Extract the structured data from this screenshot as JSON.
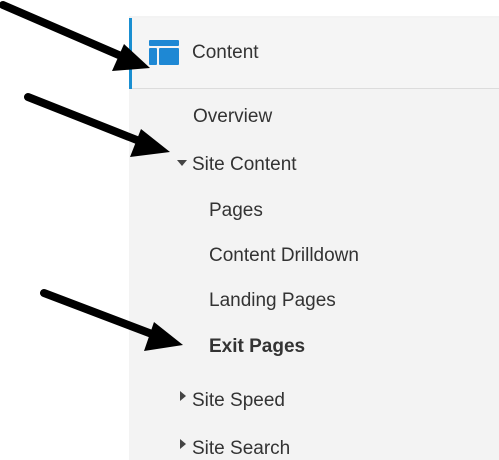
{
  "header": {
    "label": "Content",
    "icon": "content-layout-icon"
  },
  "nav": {
    "overview": "Overview",
    "site_content": {
      "label": "Site Content",
      "expanded": true,
      "children": [
        "Pages",
        "Content Drilldown",
        "Landing Pages",
        "Exit Pages"
      ],
      "selected": "Exit Pages"
    },
    "site_speed": "Site Speed",
    "site_search": "Site Search"
  },
  "annotations": {
    "arrow_count": 3,
    "arrow_color": "#000000"
  },
  "colors": {
    "accent": "#1a8fd1",
    "icon": "#1e88d4",
    "panel_bg": "#f3f3f3",
    "text": "#333333"
  }
}
